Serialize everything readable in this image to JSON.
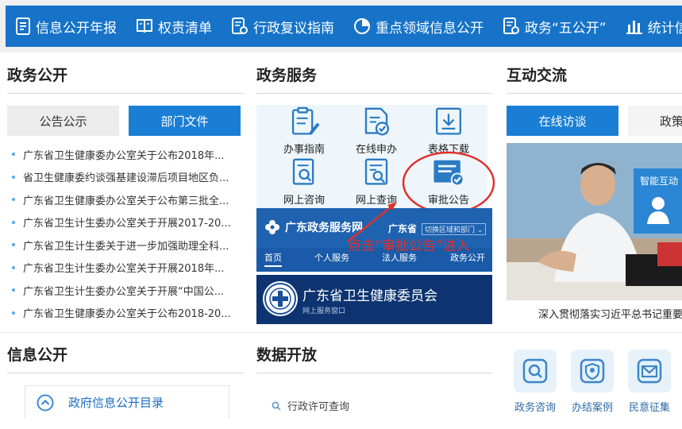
{
  "topnav": {
    "items": [
      {
        "label": "信息公开年报",
        "icon": "document-list-icon"
      },
      {
        "label": "权责清单",
        "icon": "book-icon"
      },
      {
        "label": "行政复议指南",
        "icon": "document-gear-icon"
      },
      {
        "label": "重点领域信息公开",
        "icon": "pie-chart-icon"
      },
      {
        "label": "政务“五公开”",
        "icon": "document-gear-icon"
      },
      {
        "label": "统计信",
        "icon": "bar-chart-icon"
      }
    ]
  },
  "zwgk": {
    "title": "政务公开",
    "tabs": [
      "公告公示",
      "部门文件"
    ],
    "news": [
      "广东省卫生健康委办公室关于公布2018年...",
      "省卫生健康委约谈强基建设滞后项目地区负...",
      "广东省卫生健康委办公室关于公布第三批全...",
      "广东省卫生计生委办公室关于开展2017-20...",
      "广东省卫生计生委关于进一步加强助理全科...",
      "广东省卫生计生委办公室关于开展2018年...",
      "广东省卫生计生委办公室关于开展“中国公...",
      "广东省卫生健康委办公室关于公布2018-20..."
    ]
  },
  "zwfw": {
    "title": "政务服务",
    "services": [
      {
        "label": "办事指南",
        "icon": "clipboard-pen-icon"
      },
      {
        "label": "在线申办",
        "icon": "document-check-icon"
      },
      {
        "label": "表格下载",
        "icon": "download-icon"
      },
      {
        "label": "网上咨询",
        "icon": "document-search-icon"
      },
      {
        "label": "网上查询",
        "icon": "document-search-icon"
      },
      {
        "label": "审批公告",
        "icon": "approval-check-icon"
      }
    ],
    "banner": {
      "brand": "广东政务服务网",
      "province": "广东省",
      "switch": "切换区域和部门 ⌄",
      "subnav": [
        "首页",
        "个人服务",
        "法人服务",
        "政务公开"
      ]
    },
    "wj": {
      "title": "广东省卫生健康委员会",
      "subtitle": "网上服务窗口"
    },
    "annotation": "点击“审批公告”进入",
    "annotation_color": "#e0302c"
  },
  "hdjl": {
    "title": "互动交流",
    "tabs": [
      "在线访谈",
      "政策"
    ],
    "smart": "智能互动",
    "caption": "深入贯彻落实习近平总书记重要"
  },
  "xxgk": {
    "title": "信息公开",
    "item": "政府信息公开目录"
  },
  "sjkf": {
    "title": "数据开放",
    "search": "行政许可查询"
  },
  "quick": [
    {
      "label": "政务咨询",
      "icon": "consult-search-icon"
    },
    {
      "label": "办结案例",
      "icon": "case-shield-icon"
    },
    {
      "label": "民意征集",
      "icon": "mail-icon"
    }
  ]
}
